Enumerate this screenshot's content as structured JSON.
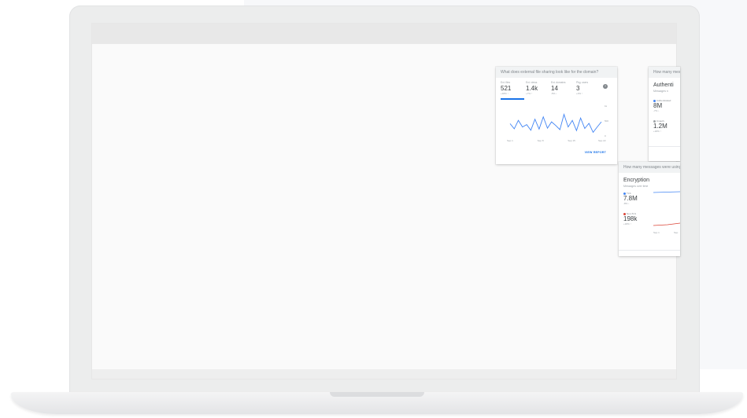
{
  "cards": {
    "file_sharing": {
      "header": "What does external file sharing look like for the domain?",
      "tabs": [
        {
          "label": "Ext. files",
          "value": "521",
          "change": "+18% ↑"
        },
        {
          "label": "Ext. views",
          "value": "1.4k",
          "change": "+7% ↑"
        },
        {
          "label": "Ext. domains",
          "value": "14",
          "change": "-5% ↓"
        },
        {
          "label": "Pkg. users",
          "value": "3",
          "change": "+0% ↑"
        }
      ],
      "help_icon": "?",
      "x_ticks": [
        "Sep 1",
        "Sep 8",
        "Sep 15",
        "Sep 22"
      ],
      "y_ticks": [
        "1k",
        "500",
        "0"
      ],
      "series": [
        {
          "color": "#4285f4",
          "values": [
            410,
            240,
            520,
            300,
            380,
            190,
            560,
            230,
            640,
            260,
            470,
            350,
            210,
            720,
            300,
            520,
            180,
            600,
            250,
            420,
            120,
            300,
            470
          ]
        }
      ],
      "view_report": "VIEW REPORT"
    },
    "authentication": {
      "header": "How many messages",
      "title": "Authenti",
      "subtitle": "Messages n",
      "metrics": [
        {
          "legend": "Authenticated",
          "value": "8M",
          "change": "-7% ↓",
          "color": "#4285f4"
        },
        {
          "legend": "Unauth.",
          "value": "1.2M",
          "change": "+18% ↑",
          "color": "#a0a4a8"
        }
      ]
    },
    "encryption": {
      "header": "How many messages were using",
      "title": "Encryption",
      "subtitle": "Messages over time",
      "metrics": [
        {
          "legend": "TLS",
          "value": "7.8M",
          "change": "-8% ↓",
          "color": "#4285f4"
        },
        {
          "legend": "Non-TLS",
          "value": "198k",
          "change": "+18% ↑",
          "color": "#db4437"
        }
      ],
      "x_ticks": [
        "Sep 1",
        "Sep"
      ]
    }
  }
}
